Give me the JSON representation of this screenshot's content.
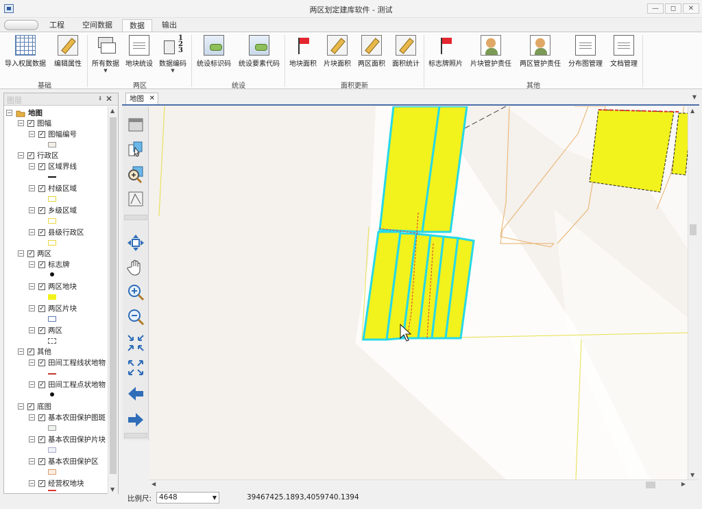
{
  "window": {
    "title": "两区划定建库软件 - 测试",
    "minimize": "—",
    "restore": "◻",
    "close": "✕"
  },
  "ribbon_tabs": [
    "工程",
    "空间数据",
    "数据",
    "输出"
  ],
  "active_tab": "数据",
  "ribbon": {
    "groups": [
      {
        "label": "基础",
        "buttons": [
          "导入权属数据",
          "编辑属性"
        ]
      },
      {
        "label": "两区",
        "buttons": [
          "所有数据",
          "地块统设",
          "数据编码"
        ]
      },
      {
        "label": "统设",
        "buttons": [
          "统设标识码",
          "统设要素代码"
        ]
      },
      {
        "label": "面积更新",
        "buttons": [
          "地块面积",
          "片块面积",
          "两区面积",
          "面积统计"
        ]
      },
      {
        "label": "其他",
        "buttons": [
          "标志牌照片",
          "片块管护责任",
          "两区管护责任",
          "分布图管理",
          "文档管理"
        ]
      }
    ]
  },
  "layer_panel": {
    "title": "图层",
    "pin": "ᵻ",
    "close": "✕",
    "nodes": [
      {
        "label": "地图"
      },
      {
        "label": "图幅"
      },
      {
        "label": "图幅编号"
      },
      {
        "label": "行政区"
      },
      {
        "label": "区域界线"
      },
      {
        "label": "村级区域"
      },
      {
        "label": "乡级区域"
      },
      {
        "label": "县级行政区"
      },
      {
        "label": "两区"
      },
      {
        "label": "标志牌"
      },
      {
        "label": "两区地块"
      },
      {
        "label": "两区片块"
      },
      {
        "label": "两区"
      },
      {
        "label": "其他"
      },
      {
        "label": "田间工程线状地物"
      },
      {
        "label": "田间工程点状地物"
      },
      {
        "label": "底图"
      },
      {
        "label": "基本农田保护图斑"
      },
      {
        "label": "基本农田保护片块"
      },
      {
        "label": "基本农田保护区"
      },
      {
        "label": "经营权地块"
      }
    ]
  },
  "tree_glyphs": {
    "collapse": "−",
    "check": "✓"
  },
  "doc_tab": {
    "label": "地图",
    "close": "✕"
  },
  "status": {
    "scale_label": "比例尺:",
    "scale_value": "4648",
    "coordinates": "39467425.1893,4059740.1394"
  },
  "colors": {
    "parcel_fill": "#f2f21c",
    "parcel_border": "#26d8e8",
    "boundary": "#e6e04a",
    "village": "#e8b06a",
    "map_bg": "#f5f1ec",
    "imagery_light": "#ffffff"
  },
  "icons": [
    "grid-table-icon",
    "edit-attribute-icon",
    "layers-icon",
    "document-icon",
    "fraction-icon",
    "id-code-icon",
    "element-code-icon",
    "add-flag-icon",
    "parcel-area-icon",
    "pencil-icon",
    "flag-photo-icon",
    "person-responsibility-icon",
    "map-manage-icon",
    "document-manage-icon"
  ]
}
